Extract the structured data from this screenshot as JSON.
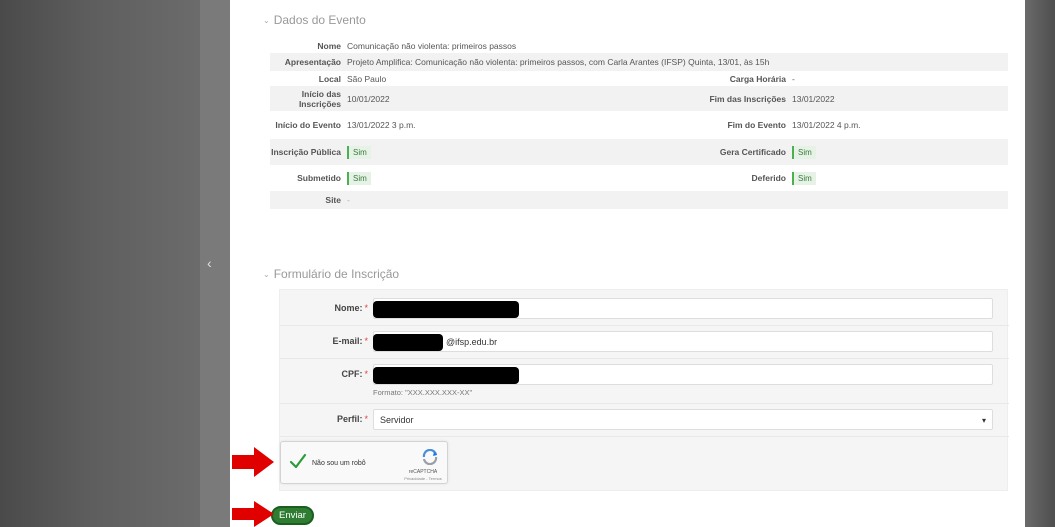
{
  "nav": {
    "prev_icon": "chevron-left-icon",
    "prev_glyph": "‹"
  },
  "event_section": {
    "title": "Dados do Evento",
    "rows": {
      "nome": {
        "label": "Nome",
        "value": "Comunicação não violenta: primeiros passos"
      },
      "apresentacao": {
        "label": "Apresentação",
        "value": "Projeto Amplifica: Comunicação não violenta: primeiros passos, com Carla Arantes (IFSP) Quinta, 13/01, às 15h"
      },
      "local": {
        "label": "Local",
        "value": "São Paulo"
      },
      "carga_horaria": {
        "label": "Carga Horária",
        "value": "-"
      },
      "inicio_inscricoes": {
        "label": "Início das Inscrições",
        "value": "10/01/2022"
      },
      "fim_inscricoes": {
        "label": "Fim das Inscrições",
        "value": "13/01/2022"
      },
      "inicio_evento": {
        "label": "Início do Evento",
        "value": "13/01/2022 3 p.m."
      },
      "fim_evento": {
        "label": "Fim do Evento",
        "value": "13/01/2022 4 p.m."
      },
      "inscricao_publica": {
        "label": "Inscrição Pública",
        "value": "Sim"
      },
      "gera_certificado": {
        "label": "Gera Certificado",
        "value": "Sim"
      },
      "submetido": {
        "label": "Submetido",
        "value": "Sim"
      },
      "deferido": {
        "label": "Deferido",
        "value": "Sim"
      },
      "site": {
        "label": "Site",
        "value": "-"
      }
    }
  },
  "form_section": {
    "title": "Formulário de Inscrição",
    "required_mark": "*",
    "nome": {
      "label": "Nome:",
      "value": ""
    },
    "email": {
      "label": "E-mail:",
      "value_suffix": "@ifsp.edu.br"
    },
    "cpf": {
      "label": "CPF:",
      "value": "",
      "hint": "Formato: \"XXX.XXX.XXX-XX\""
    },
    "perfil": {
      "label": "Perfil:",
      "selected": "Servidor"
    },
    "captcha": {
      "label": "Não sou um robô",
      "brand": "reCAPTCHA",
      "terms": "Privacidade - Termos"
    },
    "submit_label": "Enviar"
  },
  "colors": {
    "accent_green": "#2e7d32",
    "badge_bg": "#e6f2e6",
    "required_red": "#e04040",
    "annotation_arrow": "#e00000"
  }
}
